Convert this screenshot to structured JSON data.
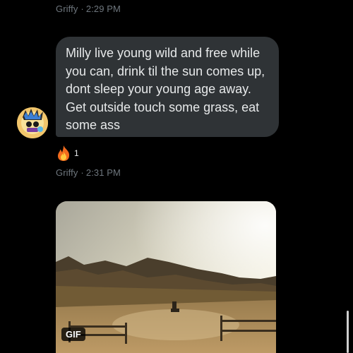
{
  "messages": [
    {
      "sender": "Griffy",
      "time": "2:29 PM",
      "text": "Milly live young wild and free while you can, drink til the sun comes up, dont sleep your young age away. Get outside touch some grass, eat some ass",
      "reaction": {
        "emoji": "fire-icon",
        "count": "1"
      }
    },
    {
      "sender": "Griffy",
      "time": "2:31 PM",
      "media": {
        "type": "gif",
        "badge": "GIF"
      }
    }
  ],
  "separator": "·",
  "colors": {
    "background": "#000000",
    "bubble": "#2f3336",
    "bubble_text": "#e7e9ea",
    "meta_text": "#6e767d"
  }
}
